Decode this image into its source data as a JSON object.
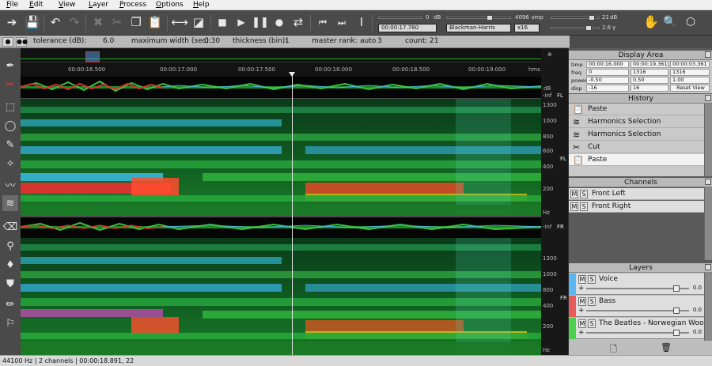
{
  "menu": [
    "File",
    "Edit",
    "View",
    "Layer",
    "Process",
    "Options",
    "Help"
  ],
  "toolbar": {
    "time_field": "00:00:17.760",
    "time_field_value": "0",
    "db_unit": "dB",
    "fft_size": "4096",
    "smp_unit": "smp",
    "window": "Blackman-Harris",
    "oversample": "x16",
    "db_value": "21",
    "db_unit2": "dB",
    "gamma_value": "2.6",
    "gamma_unit": "γ"
  },
  "options": {
    "tolerance_label": "tolerance (dB):",
    "tolerance_value": "6.0",
    "max_width_label": "maximum width (sec):",
    "max_width_value": "0.30",
    "thickness_label": "thickness (bin):",
    "thickness_value": "1",
    "master_rank_label": "master rank:",
    "master_rank_value": "auto",
    "master_rank_num": "3",
    "count_label": "count:",
    "count_value": "21"
  },
  "ruler": {
    "ticks": [
      "00:00:16.500",
      "00:00:17.000",
      "00:00:17.500",
      "00:00:18.000",
      "00:00:18.500",
      "00:00:19.000"
    ],
    "unit": "hms"
  },
  "channel_labels": {
    "ch1": "FL",
    "ch2": "FR"
  },
  "wave_axis": {
    "label1": "-inf",
    "label2": "-inf",
    "db": "dB"
  },
  "freq_axis": {
    "ticks": [
      "1300",
      "1000",
      "800",
      "600",
      "400",
      "200"
    ],
    "unit": "Hz"
  },
  "display_area": {
    "title": "Display Area",
    "rows": [
      {
        "label": "time",
        "a": "00:00:16.000",
        "b": "00:00:19.361",
        "c": "00:00:03.361"
      },
      {
        "label": "freq",
        "a": "0",
        "b": "1316",
        "c": "1316"
      },
      {
        "label": "power",
        "a": "-0.50",
        "b": "0.50",
        "c": "1.00"
      },
      {
        "label": "disp",
        "a": "-16",
        "b": "16",
        "c": "Reset View"
      }
    ]
  },
  "history": {
    "title": "History",
    "items": [
      {
        "label": "Paste",
        "icon": "paste-icon"
      },
      {
        "label": "Harmonics Selection",
        "icon": "harmonics-icon"
      },
      {
        "label": "Harmonics Selection",
        "icon": "harmonics-icon"
      },
      {
        "label": "Cut",
        "icon": "scissors-icon"
      },
      {
        "label": "Paste",
        "icon": "paste-icon"
      }
    ]
  },
  "channels": {
    "title": "Channels",
    "items": [
      {
        "m": "M",
        "s": "S",
        "label": "Front Left"
      },
      {
        "m": "M",
        "s": "S",
        "label": "Front Right"
      }
    ]
  },
  "layers": {
    "title": "Layers",
    "items": [
      {
        "label": "Voice",
        "color": "#59b6f0",
        "gain": "0.0",
        "level": 0.88
      },
      {
        "label": "Bass",
        "color": "#e85b5b",
        "gain": "0.0",
        "level": 0.88
      },
      {
        "label": "The Beatles - Norwegian Wood (This",
        "color": "#4ccf4c",
        "gain": "0.0",
        "level": 0.88
      }
    ]
  },
  "status": "44100 Hz | 2 channels | 00:00:18.891, 22"
}
